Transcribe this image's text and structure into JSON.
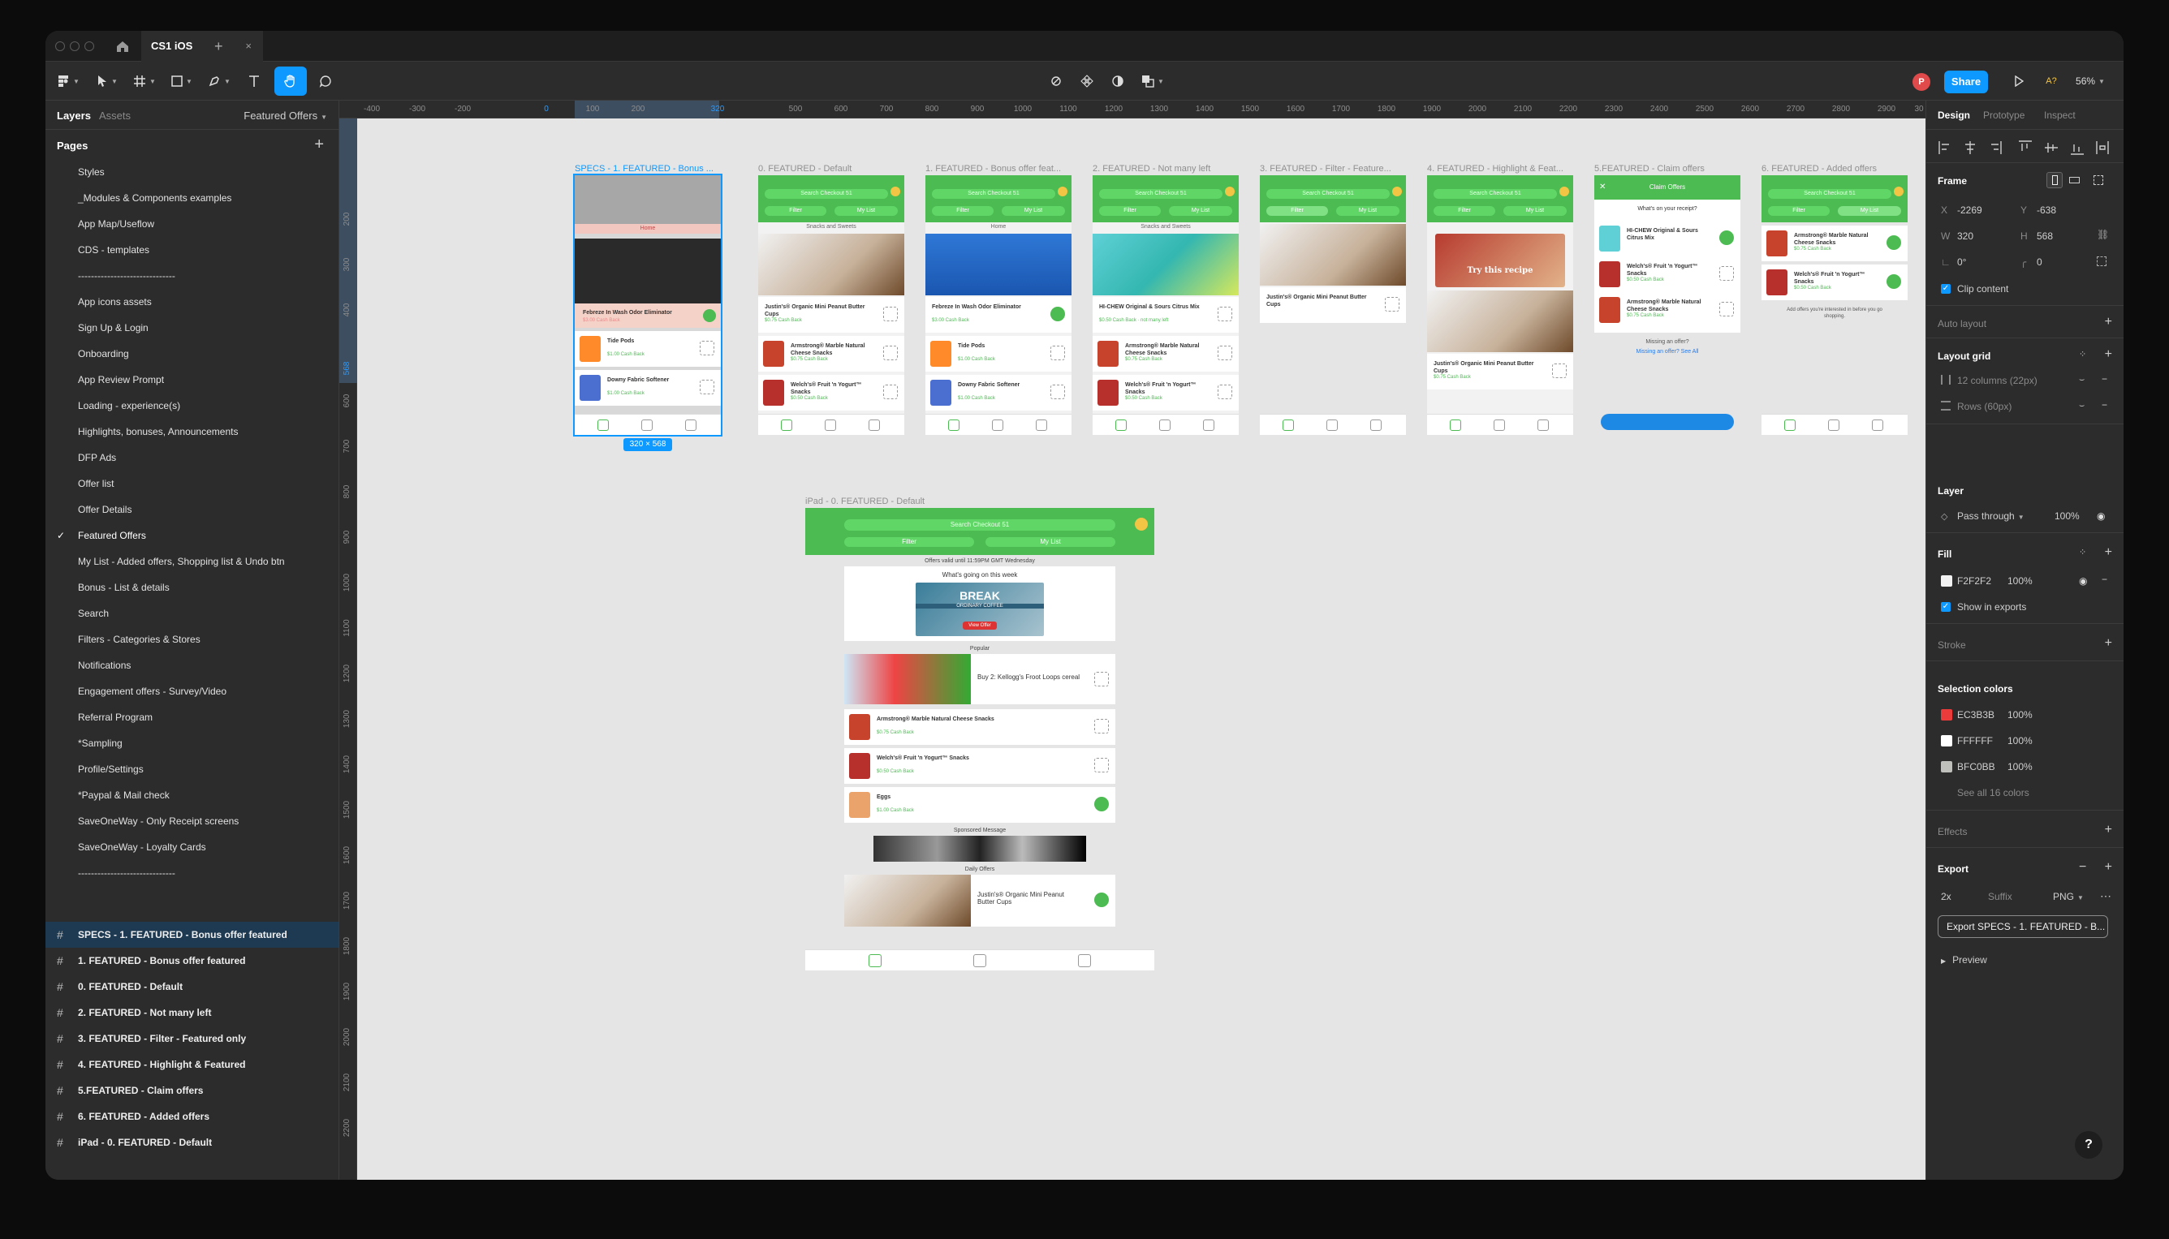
{
  "titlebar": {
    "tab_title": "CS1 iOS",
    "tab_close": "×",
    "new_tab": "+"
  },
  "toolbar": {
    "share_label": "Share",
    "avatar_initial": "P",
    "zoom": "56%",
    "a_label": "A?"
  },
  "left_panel": {
    "tab_layers": "Layers",
    "tab_assets": "Assets",
    "current_page": "Featured Offers",
    "pages_header": "Pages",
    "pages": [
      "Styles",
      "_Modules & Components examples",
      "App Map/Useflow",
      "CDS - templates",
      "------------------------------",
      "App icons assets",
      "Sign Up & Login",
      "Onboarding",
      "App Review Prompt",
      "Loading - experience(s)",
      "Highlights, bonuses, Announcements",
      "DFP Ads",
      "Offer list",
      "Offer Details",
      "Featured Offers",
      "My List - Added offers, Shopping list & Undo btn",
      "Bonus - List & details",
      "Search",
      "Filters - Categories & Stores",
      "Notifications",
      "Engagement offers - Survey/Video",
      "Referral Program",
      "*Sampling",
      "Profile/Settings",
      "*Paypal & Mail check",
      "SaveOneWay - Only Receipt screens",
      "SaveOneWay - Loyalty Cards",
      "------------------------------"
    ],
    "frames": [
      "SPECS - 1. FEATURED - Bonus offer featured",
      "1. FEATURED - Bonus offer featured",
      "0. FEATURED - Default",
      "2. FEATURED - Not many left",
      "3. FEATURED - Filter - Featured only",
      "4. FEATURED - Highlight & Featured",
      "5.FEATURED - Claim offers",
      "6. FEATURED - Added offers",
      "iPad - 0. FEATURED - Default"
    ]
  },
  "canvas": {
    "ruler_top": [
      "-400",
      "-300",
      "-200",
      "0",
      "100",
      "200",
      "320",
      "500",
      "600",
      "700",
      "800",
      "900",
      "1000",
      "1100",
      "1200",
      "1300",
      "1400",
      "1500",
      "1600",
      "1700",
      "1800",
      "1900",
      "2000",
      "2100",
      "2200",
      "2300",
      "2400",
      "2500",
      "2600",
      "2700",
      "2800",
      "2900",
      "30"
    ],
    "ruler_left": [
      "200",
      "300",
      "400",
      "568",
      "600",
      "700",
      "800",
      "900",
      "1000",
      "1100",
      "1200",
      "1300",
      "1400",
      "1500",
      "1600",
      "1700",
      "1800",
      "1900",
      "2000",
      "2100",
      "2200"
    ],
    "frame_labels": [
      "SPECS - 1. FEATURED - Bonus ...",
      "0. FEATURED - Default",
      "1. FEATURED - Bonus offer feat...",
      "2. FEATURED - Not many left",
      "3. FEATURED - Filter - Feature...",
      "4. FEATURED - Highlight & Feat...",
      "5.FEATURED - Claim offers",
      "6. FEATURED - Added offers"
    ],
    "ipad_label": "iPad - 0. FEATURED - Default",
    "size_badge": "320 × 568",
    "mock": {
      "search": "Search Checkout 51",
      "filter": "Filter",
      "my_list": "My List",
      "section_snacks": "Snacks and Sweets",
      "section_home": "Home",
      "claim_title": "Claim Offers",
      "whats_on_receipt": "What's on your receipt?",
      "missing_offer": "Missing an offer?",
      "see_all": "Missing an offer? See All",
      "added_note": "Add offers you're interested in before you go shopping.",
      "items": [
        {
          "name": "Justin's® Organic Mini Peanut Butter Cups",
          "cb": "$0.75 Cash Back"
        },
        {
          "name": "Febreze In Wash Odor Eliminator",
          "cb": "$3.00 Cash Back"
        },
        {
          "name": "HI-CHEW Original & Sours Citrus Mix",
          "cb": "$0.50 Cash Back · not many left"
        },
        {
          "name": "Tide Pods",
          "cb": "$1.00 Cash Back"
        },
        {
          "name": "Armstrong® Marble Natural Cheese Snacks",
          "cb": "$0.75 Cash Back"
        },
        {
          "name": "Downy Fabric Softener",
          "cb": "$1.00 Cash Back"
        },
        {
          "name": "Welch's® Fruit 'n Yogurt™ Snacks",
          "cb": "$0.50 Cash Back"
        }
      ],
      "ipad": {
        "offers_until": "Offers valid until 11:59PM GMT Wednesday",
        "whats_going_on": "What's going on this week",
        "break_title": "BREAK",
        "break_sub": "ORDINARY COFFEE",
        "break_btn": "View Offer",
        "popular": "Popular",
        "kelloggs": "Buy 2: Kellogg's Froot Loops cereal",
        "eggs": "Eggs",
        "eggs_cb": "$1.00 Cash Back",
        "sponsored": "Sponsored Message",
        "daily": "Daily Offers",
        "try_recipe": "Try this recipe"
      }
    }
  },
  "right_panel": {
    "tabs": [
      "Design",
      "Prototype",
      "Inspect"
    ],
    "frame_label": "Frame",
    "x_label": "X",
    "x_value": "-2269",
    "y_label": "Y",
    "y_value": "-638",
    "w_label": "W",
    "w_value": "320",
    "h_label": "H",
    "h_value": "568",
    "rotation": "0°",
    "radius": "0",
    "clip_content": "Clip content",
    "auto_layout": "Auto layout",
    "layout_grid": "Layout grid",
    "grid_columns": "12 columns (22px)",
    "grid_rows": "Rows (60px)",
    "layer": "Layer",
    "blend_mode": "Pass through",
    "layer_opacity": "100%",
    "fill": "Fill",
    "fill_hex": "F2F2F2",
    "fill_opacity": "100%",
    "show_in_exports": "Show in exports",
    "stroke": "Stroke",
    "selection_colors": "Selection colors",
    "colors": [
      {
        "hex": "EC3B3B",
        "opacity": "100%",
        "color": "#EC3B3B"
      },
      {
        "hex": "FFFFFF",
        "opacity": "100%",
        "color": "#FFFFFF"
      },
      {
        "hex": "BFC0BB",
        "opacity": "100%",
        "color": "#BFC0BB"
      }
    ],
    "see_all_colors": "See all 16 colors",
    "effects": "Effects",
    "export": "Export",
    "export_scale": "2x",
    "export_suffix": "Suffix",
    "export_format": "PNG",
    "export_button": "Export SPECS - 1. FEATURED - B...",
    "preview": "Preview"
  },
  "colors": {
    "accent": "#0d99ff",
    "green": "#4cbb52",
    "canvas": "#e5e5e5"
  }
}
